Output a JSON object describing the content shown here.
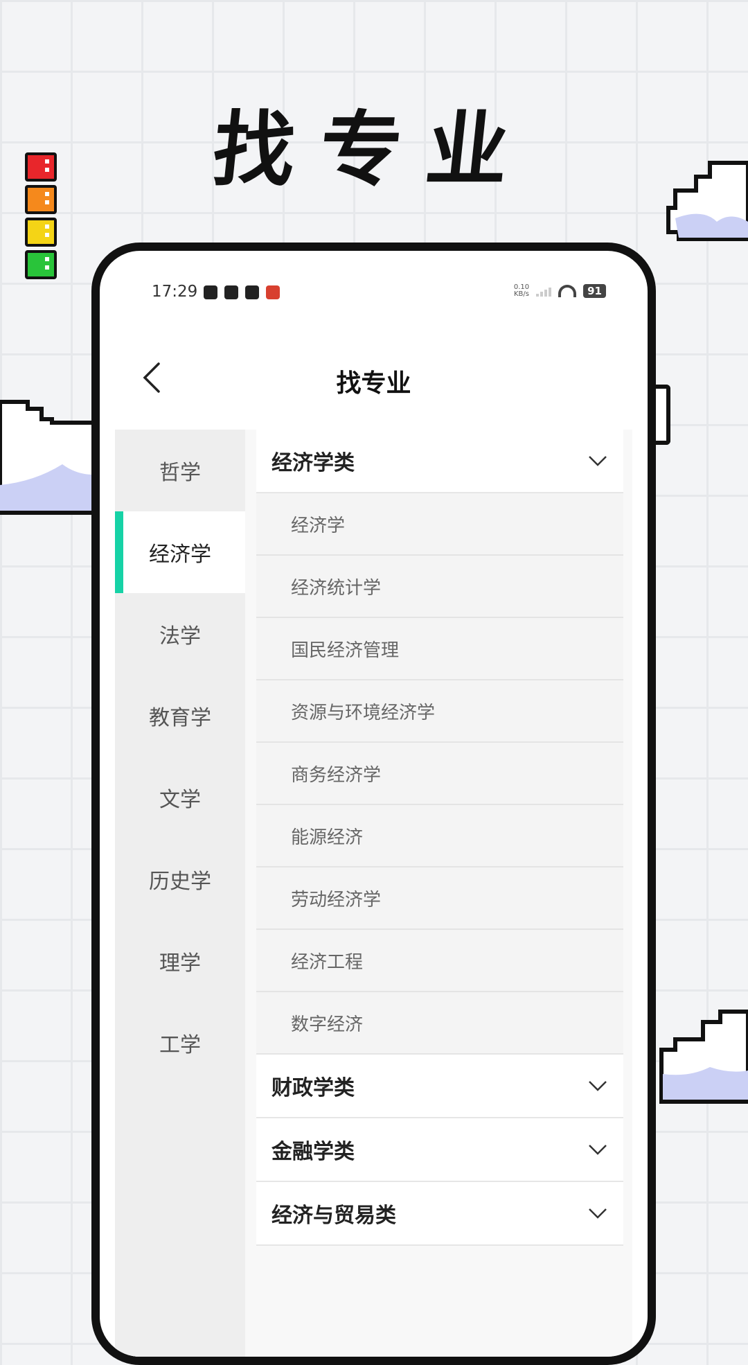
{
  "hero": {
    "title": "找专业"
  },
  "status": {
    "time": "17:29",
    "net_speed": "0.10",
    "net_unit": "KB/s",
    "battery": "91"
  },
  "nav": {
    "title": "找专业"
  },
  "categories": [
    "哲学",
    "经济学",
    "法学",
    "教育学",
    "文学",
    "历史学",
    "理学",
    "工学"
  ],
  "active_category": "经济学",
  "groups": [
    {
      "title": "经济学类",
      "items": [
        "经济学",
        "经济统计学",
        "国民经济管理",
        "资源与环境经济学",
        "商务经济学",
        "能源经济",
        "劳动经济学",
        "经济工程",
        "数字经济"
      ]
    },
    {
      "title": "财政学类"
    },
    {
      "title": "金融学类"
    },
    {
      "title": "经济与贸易类"
    }
  ],
  "colors": {
    "accent": "#16d2a6",
    "light_red": "#e8262b",
    "light_orange": "#f5891c",
    "light_yellow": "#f4d416",
    "light_green": "#29c43a"
  },
  "icons": [
    "back-arrow-icon",
    "chevron-down-icon",
    "wifi-icon",
    "battery-icon"
  ]
}
